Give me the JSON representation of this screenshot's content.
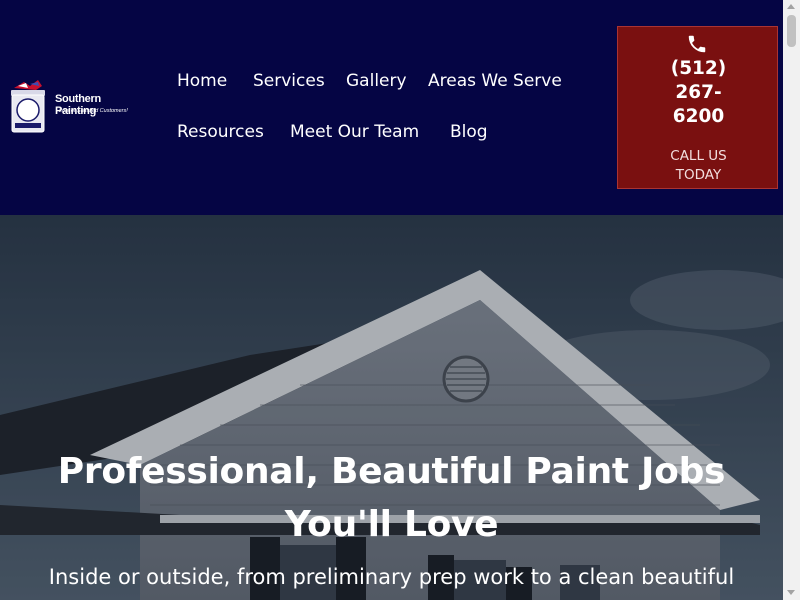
{
  "logo": {
    "brand": "Southern Painting",
    "tagline": "Lots of Satisfied Customers!",
    "can_text": "Southern Painting",
    "can_since": "Since 1969"
  },
  "nav": {
    "items": [
      {
        "label": "Home"
      },
      {
        "label": "Services"
      },
      {
        "label": "Gallery"
      },
      {
        "label": "Areas We Serve"
      },
      {
        "label": "Resources"
      },
      {
        "label": "Meet Our Team"
      },
      {
        "label": "Blog"
      }
    ]
  },
  "cta": {
    "phone_icon": "phone-icon",
    "number_line1": "(512)",
    "number_line2": "267-",
    "number_line3": "6200",
    "call_line1": "CALL US",
    "call_line2": "TODAY",
    "bg_color": "#7a1010"
  },
  "hero": {
    "heading_line1": "Professional, Beautiful Paint Jobs",
    "heading_line2": "You'll Love",
    "subtext": "Inside or outside, from preliminary prep work to a clean beautiful"
  },
  "colors": {
    "header_bg": "#050544",
    "accent_red": "#7a1010"
  }
}
